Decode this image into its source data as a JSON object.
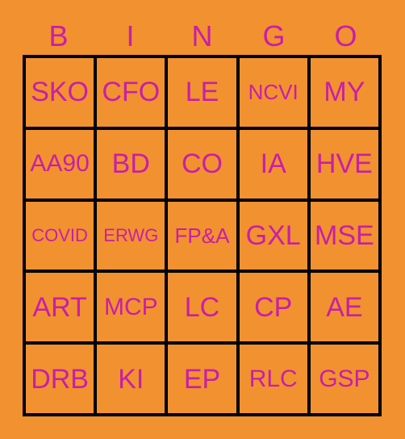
{
  "card": {
    "title": "BINGO",
    "background_color": "#F2912F",
    "text_color": "#C71FA8",
    "border_color": "#000000"
  },
  "header": {
    "letters": [
      "B",
      "I",
      "N",
      "G",
      "O"
    ]
  },
  "grid": {
    "rows": 5,
    "columns": 5,
    "cells": [
      [
        {
          "label": "SKO",
          "size": "xl"
        },
        {
          "label": "CFO",
          "size": "xl"
        },
        {
          "label": "LE",
          "size": "xl"
        },
        {
          "label": "NCVI",
          "size": "md"
        },
        {
          "label": "MY",
          "size": "xl"
        }
      ],
      [
        {
          "label": "AA90",
          "size": "lg"
        },
        {
          "label": "BD",
          "size": "xl"
        },
        {
          "label": "CO",
          "size": "xl"
        },
        {
          "label": "IA",
          "size": "xl"
        },
        {
          "label": "HVE",
          "size": "xl"
        }
      ],
      [
        {
          "label": "COVID",
          "size": "sm"
        },
        {
          "label": "ERWG",
          "size": "sm"
        },
        {
          "label": "FP&A",
          "size": "md"
        },
        {
          "label": "GXL",
          "size": "xl"
        },
        {
          "label": "MSE",
          "size": "xl"
        }
      ],
      [
        {
          "label": "ART",
          "size": "xl"
        },
        {
          "label": "MCP",
          "size": "lg"
        },
        {
          "label": "LC",
          "size": "xl"
        },
        {
          "label": "CP",
          "size": "xl"
        },
        {
          "label": "AE",
          "size": "xl"
        }
      ],
      [
        {
          "label": "DRB",
          "size": "xl"
        },
        {
          "label": "KI",
          "size": "xl"
        },
        {
          "label": "EP",
          "size": "xl"
        },
        {
          "label": "RLC",
          "size": "lg"
        },
        {
          "label": "GSP",
          "size": "lg"
        }
      ]
    ]
  }
}
